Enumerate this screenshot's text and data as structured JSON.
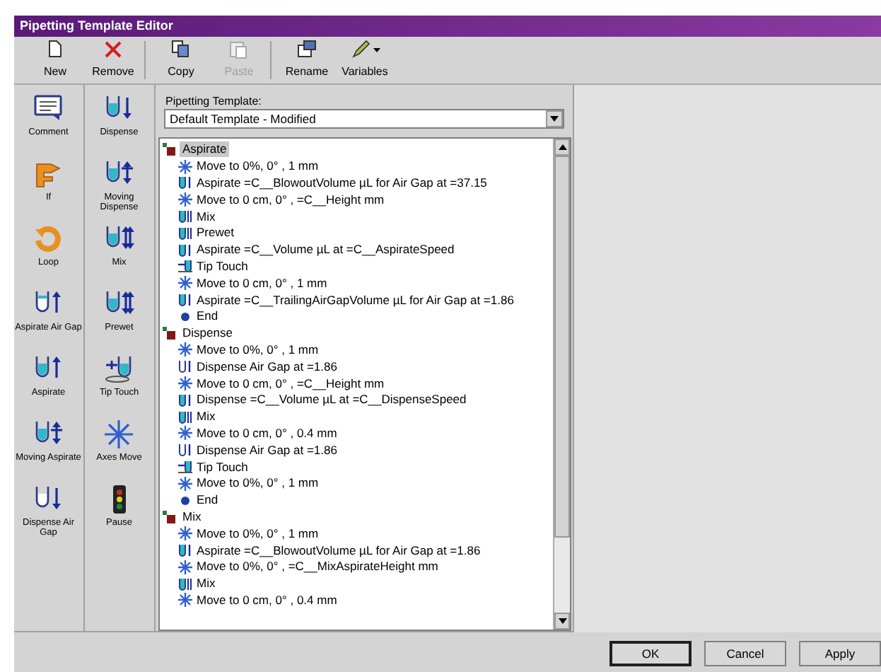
{
  "window": {
    "title": "Pipetting Template Editor"
  },
  "toolbar": [
    {
      "label": "New",
      "kind": "new",
      "disabled": false
    },
    {
      "label": "Remove",
      "kind": "remove",
      "disabled": false
    },
    {
      "label": "Copy",
      "kind": "copy",
      "disabled": false
    },
    {
      "label": "Paste",
      "kind": "paste",
      "disabled": true
    },
    {
      "label": "Rename",
      "kind": "rename",
      "disabled": false
    },
    {
      "label": "Variables",
      "kind": "variables",
      "disabled": false
    }
  ],
  "palette": {
    "column_1": [
      {
        "label": "Comment",
        "kind": "comment"
      },
      {
        "label": "If",
        "kind": "if"
      },
      {
        "label": "Loop",
        "kind": "loop"
      },
      {
        "label": "Aspirate Air Gap",
        "kind": "aspirate-air-gap"
      },
      {
        "label": "Aspirate",
        "kind": "aspirate"
      },
      {
        "label": "Moving Aspirate",
        "kind": "moving-aspirate"
      },
      {
        "label": "Dispense Air Gap",
        "kind": "dispense-air-gap"
      }
    ],
    "column_2": [
      {
        "label": "Dispense",
        "kind": "dispense"
      },
      {
        "label": "Moving Dispense",
        "kind": "moving-dispense"
      },
      {
        "label": "Mix",
        "kind": "mix"
      },
      {
        "label": "Prewet",
        "kind": "prewet"
      },
      {
        "label": "Tip Touch",
        "kind": "tip-touch"
      },
      {
        "label": "Axes Move",
        "kind": "axes-move"
      },
      {
        "label": "Pause",
        "kind": "pause"
      }
    ]
  },
  "template": {
    "label": "Pipetting Template:",
    "value": "Default Template - Modified"
  },
  "tree": [
    {
      "label": "Aspirate",
      "selected": true,
      "children": [
        {
          "label": "Move to 0%, 0° , 1 mm",
          "kind": "move"
        },
        {
          "label": "Aspirate =C__BlowoutVolume µL for Air Gap at =37.15",
          "kind": "aspirate"
        },
        {
          "label": "Move to 0 cm, 0° , =C__Height mm",
          "kind": "move"
        },
        {
          "label": "Mix",
          "kind": "mix"
        },
        {
          "label": "Prewet",
          "kind": "mix"
        },
        {
          "label": "Aspirate =C__Volume µL at =C__AspirateSpeed",
          "kind": "aspirate"
        },
        {
          "label": "Tip Touch",
          "kind": "tip-touch"
        },
        {
          "label": "Move to 0 cm, 0° , 1 mm",
          "kind": "move"
        },
        {
          "label": "Aspirate =C__TrailingAirGapVolume µL for Air Gap at =1.86",
          "kind": "aspirate"
        },
        {
          "label": "End",
          "kind": "end"
        }
      ]
    },
    {
      "label": "Dispense",
      "selected": false,
      "children": [
        {
          "label": "Move to 0%, 0° , 1 mm",
          "kind": "move"
        },
        {
          "label": "Dispense Air Gap at =1.86",
          "kind": "dispense-air-gap"
        },
        {
          "label": "Move to 0 cm, 0° , =C__Height mm",
          "kind": "move"
        },
        {
          "label": "Dispense =C__Volume µL at =C__DispenseSpeed",
          "kind": "dispense"
        },
        {
          "label": "Mix",
          "kind": "mix"
        },
        {
          "label": "Move to 0 cm, 0° , 0.4 mm",
          "kind": "move"
        },
        {
          "label": "Dispense Air Gap at =1.86",
          "kind": "dispense-air-gap"
        },
        {
          "label": "Tip Touch",
          "kind": "tip-touch"
        },
        {
          "label": "Move to 0%, 0° , 1 mm",
          "kind": "move"
        },
        {
          "label": "End",
          "kind": "end"
        }
      ]
    },
    {
      "label": "Mix",
      "selected": false,
      "children": [
        {
          "label": "Move to 0%, 0° , 1 mm",
          "kind": "move"
        },
        {
          "label": "Aspirate =C__BlowoutVolume µL for Air Gap at =1.86",
          "kind": "aspirate"
        },
        {
          "label": "Move to 0%, 0° , =C__MixAspirateHeight mm",
          "kind": "move"
        },
        {
          "label": "Mix",
          "kind": "mix"
        },
        {
          "label": "Move to 0 cm, 0° , 0.4 mm",
          "kind": "move"
        }
      ]
    }
  ],
  "buttons": [
    {
      "label": "OK",
      "default": true
    },
    {
      "label": "Cancel",
      "default": false
    },
    {
      "label": "Apply",
      "default": false
    }
  ]
}
